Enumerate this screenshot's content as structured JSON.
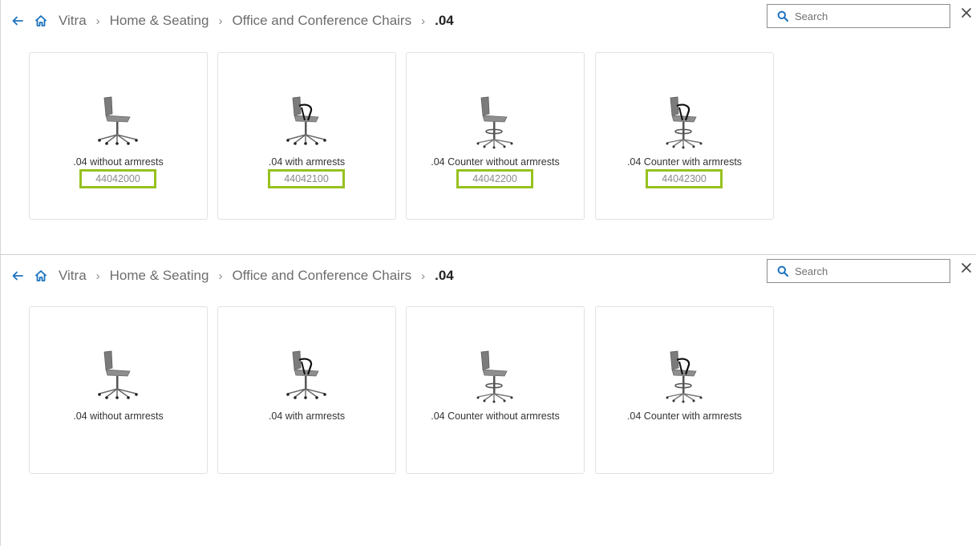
{
  "colors": {
    "accent_blue": "#1e73be",
    "highlight_green": "#97c11f",
    "text_grey": "#6d6d6d",
    "border": "#e1e1e1"
  },
  "panels": [
    {
      "breadcrumb": [
        "Vitra",
        "Home & Seating",
        "Office and Conference Chairs",
        ".04"
      ],
      "search_placeholder": "Search",
      "products": [
        {
          "name": ".04 without armrests",
          "code": "44042000",
          "variant": "swivel",
          "armrests": false
        },
        {
          "name": ".04 with armrests",
          "code": "44042100",
          "variant": "swivel",
          "armrests": true
        },
        {
          "name": ".04 Counter without armrests",
          "code": "44042200",
          "variant": "counter",
          "armrests": false
        },
        {
          "name": ".04 Counter with armrests",
          "code": "44042300",
          "variant": "counter",
          "armrests": true
        }
      ]
    },
    {
      "breadcrumb": [
        "Vitra",
        "Home & Seating",
        "Office and Conference Chairs",
        ".04"
      ],
      "search_placeholder": "Search",
      "products": [
        {
          "name": ".04 without armrests",
          "variant": "swivel",
          "armrests": false
        },
        {
          "name": ".04 with armrests",
          "variant": "swivel",
          "armrests": true
        },
        {
          "name": ".04 Counter without armrests",
          "variant": "counter",
          "armrests": false
        },
        {
          "name": ".04 Counter with armrests",
          "variant": "counter",
          "armrests": true
        }
      ]
    }
  ],
  "icons": {
    "back": "arrow-left-icon",
    "home": "home-icon",
    "search": "magnifier-icon",
    "close": "close-icon"
  }
}
